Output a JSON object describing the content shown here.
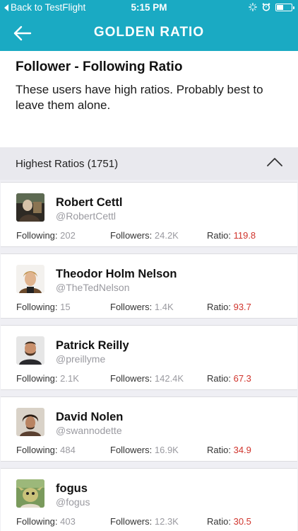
{
  "status_bar": {
    "back_label": "Back to TestFlight",
    "time": "5:15 PM"
  },
  "nav": {
    "title": "GOLDEN RATIO"
  },
  "intro": {
    "heading": "Follower - Following Ratio",
    "description": "These users have high ratios. Probably best to leave them alone."
  },
  "section": {
    "title": "Highest Ratios (1751)"
  },
  "stat_labels": {
    "following": "Following:",
    "followers": "Followers:",
    "ratio": "Ratio:"
  },
  "users": [
    {
      "name": "Robert Cettl",
      "handle": "@RobertCettl",
      "following": "202",
      "followers": "24.2K",
      "ratio": "119.8"
    },
    {
      "name": "Theodor Holm Nelson",
      "handle": "@TheTedNelson",
      "following": "15",
      "followers": "1.4K",
      "ratio": "93.7"
    },
    {
      "name": "Patrick Reilly",
      "handle": "@preillyme",
      "following": "2.1K",
      "followers": "142.4K",
      "ratio": "67.3"
    },
    {
      "name": "David Nolen",
      "handle": "@swannodette",
      "following": "484",
      "followers": "16.9K",
      "ratio": "34.9"
    },
    {
      "name": "fogus",
      "handle": "@fogus",
      "following": "403",
      "followers": "12.3K",
      "ratio": "30.5"
    }
  ],
  "colors": {
    "accent": "#1aaac3",
    "ratio_value": "#d0342c",
    "muted": "#9a9aa0"
  }
}
